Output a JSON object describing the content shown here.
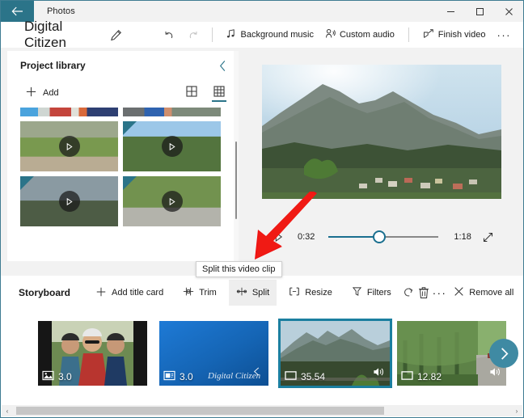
{
  "window": {
    "app_name": "Photos",
    "back_icon": "back-arrow-icon",
    "minimize_label": "–",
    "maximize_label": "❑",
    "close_label": "✕",
    "accent_color": "#2b7489",
    "titlebar_bg": "#f2f2f2"
  },
  "toolbar": {
    "project_title": "Digital Citizen",
    "edit_icon": "pencil-icon",
    "undo_icon": "undo-icon",
    "redo_icon": "redo-icon",
    "background_music": "Background music",
    "custom_audio": "Custom audio",
    "finish_video": "Finish video",
    "more_label": "···"
  },
  "library": {
    "title": "Project library",
    "collapse_icon": "chevron-left-icon",
    "add_label": "Add",
    "add_icon": "plus-icon",
    "view_large_icon": "grid-large-icon",
    "view_small_icon": "grid-small-icon",
    "active_view": "grid-small-icon",
    "items": [
      {
        "name": "filmstrip-clip-a",
        "style": "g-strip1",
        "clipped": true,
        "play": false,
        "corner": false
      },
      {
        "name": "filmstrip-clip-b",
        "style": "g-strip2",
        "clipped": true,
        "play": false,
        "corner": false
      },
      {
        "name": "swing-playground-clip",
        "style": "g-swing",
        "clipped": false,
        "play": true,
        "corner": false
      },
      {
        "name": "forest-sky-clip",
        "style": "g-trees",
        "clipped": false,
        "play": true,
        "corner": true
      },
      {
        "name": "mountain-haze-clip",
        "style": "g-mtn2",
        "clipped": false,
        "play": true,
        "corner": true
      },
      {
        "name": "tree-lined-road-clip",
        "style": "g-road",
        "clipped": false,
        "play": true,
        "corner": true
      }
    ]
  },
  "preview": {
    "frame_alt": "mountain-ridge-over-town",
    "play_icon": "play-icon",
    "current_time": "0:32",
    "total_time": "1:18",
    "fullscreen_icon": "expand-icon",
    "progress_percent": 46
  },
  "annotation": {
    "arrow_color": "#ee1111",
    "name": "red-pointer-arrow"
  },
  "tooltip": {
    "text": "Split this video clip"
  },
  "storyboard": {
    "label": "Storyboard",
    "add_title_card": "Add title card",
    "trim": "Trim",
    "split": "Split",
    "resize": "Resize",
    "filters": "Filters",
    "rotate_icon": "rotate-icon",
    "delete_icon": "trash-icon",
    "more_label": "···",
    "remove_all": "Remove all",
    "hovered_item": "Split",
    "next_icon": "chevron-right-icon",
    "clips": [
      {
        "name": "clip-cyclists-photo",
        "duration": "3.0",
        "kind_icon": "photo-icon",
        "style": "g-people",
        "selected": false,
        "audio": false,
        "title_text": ""
      },
      {
        "name": "clip-title-card",
        "duration": "3.0",
        "kind_icon": "titlecard-icon",
        "style": "g-title",
        "selected": false,
        "audio": false,
        "title_text": "Digital Citizen"
      },
      {
        "name": "clip-mountains-video",
        "duration": "35.54",
        "kind_icon": "video-icon",
        "style": "g-mount",
        "selected": true,
        "audio": true,
        "title_text": ""
      },
      {
        "name": "clip-forest-video",
        "duration": "12.82",
        "kind_icon": "video-icon",
        "style": "g-forest",
        "selected": false,
        "audio": true,
        "title_text": ""
      }
    ]
  },
  "scrollbars": {
    "h_left_arrow": "‹",
    "h_right_arrow": "›"
  }
}
